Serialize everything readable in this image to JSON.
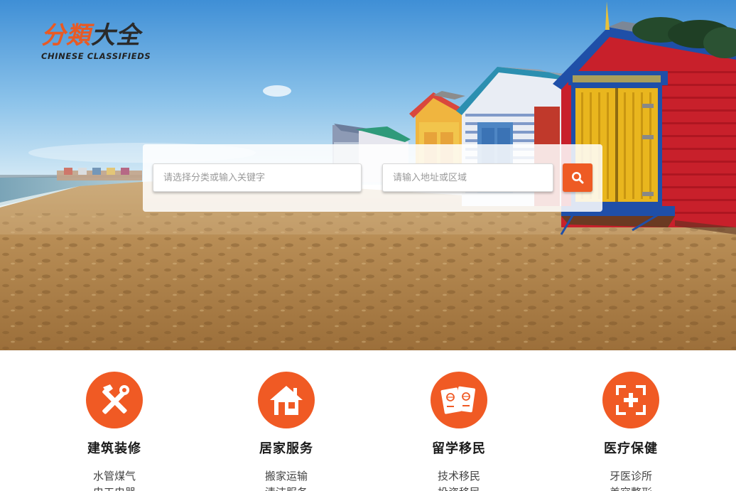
{
  "brand": {
    "logo_cn_part1": "分類",
    "logo_cn_part2": "大全",
    "logo_en": "CHINESE CLASSIFIEDS",
    "accent_color": "#ee5b24"
  },
  "search": {
    "keyword_placeholder": "请选择分类或输入关键字",
    "location_placeholder": "请输入地址或区域",
    "button_icon": "search-icon"
  },
  "categories": [
    {
      "icon": "tools-icon",
      "title": "建筑装修",
      "links": [
        "水管煤气",
        "电工电器"
      ]
    },
    {
      "icon": "house-icon",
      "title": "居家服务",
      "links": [
        "搬家运输",
        "清洁服务"
      ]
    },
    {
      "icon": "passport-icon",
      "title": "留学移民",
      "links": [
        "技术移民",
        "投资移民"
      ]
    },
    {
      "icon": "medical-icon",
      "title": "医疗保健",
      "links": [
        "牙医诊所",
        "美容整形"
      ]
    }
  ]
}
